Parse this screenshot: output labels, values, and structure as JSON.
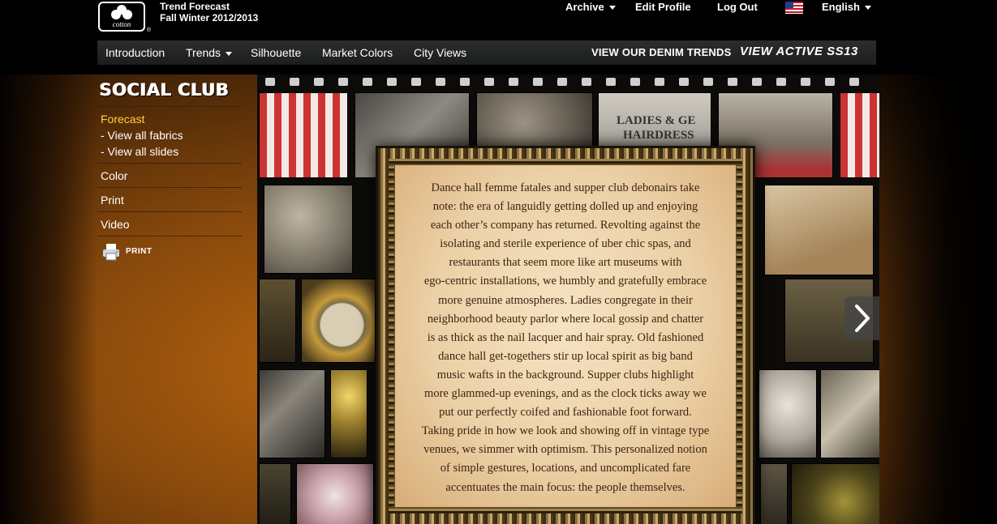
{
  "header": {
    "logo_text": "cotton",
    "logo_reg": "®",
    "title_line1": "Trend Forecast",
    "title_line2": "Fall Winter 2012/2013",
    "archive": "Archive",
    "edit_profile": "Edit Profile",
    "log_out": "Log Out",
    "language": "English"
  },
  "nav": {
    "introduction": "Introduction",
    "trends": "Trends",
    "silhouette": "Silhouette",
    "market_colors": "Market Colors",
    "city_views": "City Views",
    "denim": "VIEW OUR DENIM TRENDS",
    "active": "VIEW ACTIVE SS13"
  },
  "sidebar": {
    "title": "SOCIAL CLUB",
    "forecast": "Forecast",
    "view_fabrics": "- View all fabrics",
    "view_slides": "- View all slides",
    "color": "Color",
    "print": "Print",
    "video": "Video",
    "print_action": "PRINT"
  },
  "gallery": {
    "sign_text_1": "LADIES & GE",
    "sign_text_2": "HAIRDRESS"
  },
  "article": {
    "body": "Dance hall femme fatales and supper club debonairs take\nnote: the era of languidly getting dolled up and enjoying\neach other’s company has returned.  Revolting against the\nisolating and sterile experience of uber chic spas, and\nrestaurants that seem more like art museums with\nego-centric installations, we humbly and gratefully embrace\nmore genuine atmospheres.  Ladies congregate in their\nneighborhood beauty parlor where local gossip and chatter\nis as thick as the nail lacquer and hair spray.  Old fashioned\ndance hall get-togethers stir up local spirit as big band\nmusic wafts in the background.  Supper clubs highlight\nmore glammed-up evenings, and as the clock ticks away we\nput our perfectly coifed and fashionable foot forward.\nTaking pride in how we look and showing off in vintage type\nvenues, we simmer with optimism.  This personalized notion\nof simple gestures, locations, and uncomplicated fare\naccentuates the main focus: the people themselves."
  },
  "icons": {
    "next": "chevron-right-icon",
    "print": "printer-icon",
    "flag": "us-flag-icon"
  }
}
